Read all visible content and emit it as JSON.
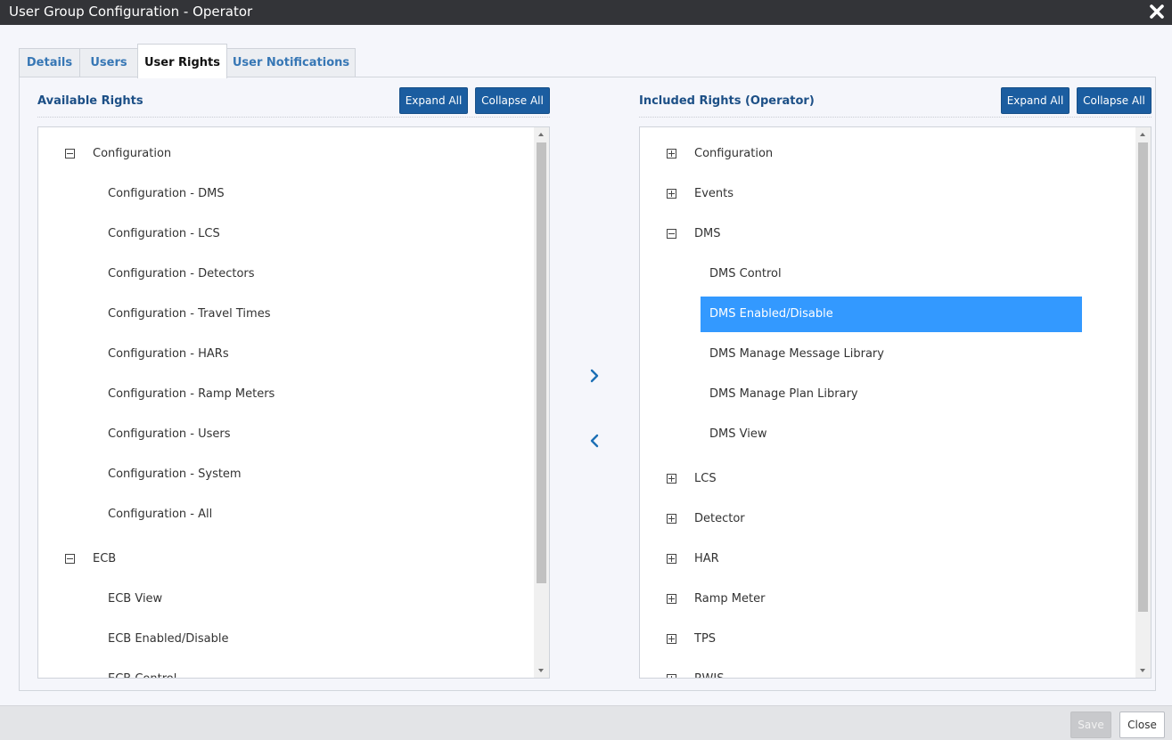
{
  "window": {
    "title": "User Group Configuration - Operator"
  },
  "tabs": [
    {
      "label": "Details"
    },
    {
      "label": "Users"
    },
    {
      "label": "User Rights"
    },
    {
      "label": "User Notifications"
    }
  ],
  "left_panel": {
    "title": "Available Rights",
    "expand_all": "Expand All",
    "collapse_all": "Collapse All",
    "items": [
      {
        "label": "Configuration",
        "toggle": "minus"
      },
      {
        "label": "Configuration - DMS"
      },
      {
        "label": "Configuration - LCS"
      },
      {
        "label": "Configuration - Detectors"
      },
      {
        "label": "Configuration - Travel Times"
      },
      {
        "label": "Configuration - HARs"
      },
      {
        "label": "Configuration - Ramp Meters"
      },
      {
        "label": "Configuration - Users"
      },
      {
        "label": "Configuration - System"
      },
      {
        "label": "Configuration - All"
      },
      {
        "label": "ECB",
        "toggle": "minus"
      },
      {
        "label": "ECB View"
      },
      {
        "label": "ECB Enabled/Disable"
      },
      {
        "label": "ECB Control"
      }
    ]
  },
  "right_panel": {
    "title": "Included Rights (Operator)",
    "expand_all": "Expand All",
    "collapse_all": "Collapse All",
    "items": [
      {
        "label": "Configuration",
        "toggle": "plus"
      },
      {
        "label": "Events",
        "toggle": "plus"
      },
      {
        "label": "DMS",
        "toggle": "minus"
      },
      {
        "label": "DMS Control"
      },
      {
        "label": "DMS Enabled/Disable",
        "selected": true
      },
      {
        "label": "DMS Manage Message Library"
      },
      {
        "label": "DMS Manage Plan Library"
      },
      {
        "label": "DMS View"
      },
      {
        "label": "LCS",
        "toggle": "plus"
      },
      {
        "label": "Detector",
        "toggle": "plus"
      },
      {
        "label": "HAR",
        "toggle": "plus"
      },
      {
        "label": "Ramp Meter",
        "toggle": "plus"
      },
      {
        "label": "TPS",
        "toggle": "plus"
      },
      {
        "label": "RWIS",
        "toggle": "plus"
      }
    ]
  },
  "footer": {
    "save_label": "Save",
    "close_label": "Close"
  },
  "colors": {
    "titlebar": "#333438",
    "accent_button": "#1b5da0",
    "tab_link": "#3777b5",
    "panel_title": "#1c4f86",
    "selection": "#3399ff"
  }
}
